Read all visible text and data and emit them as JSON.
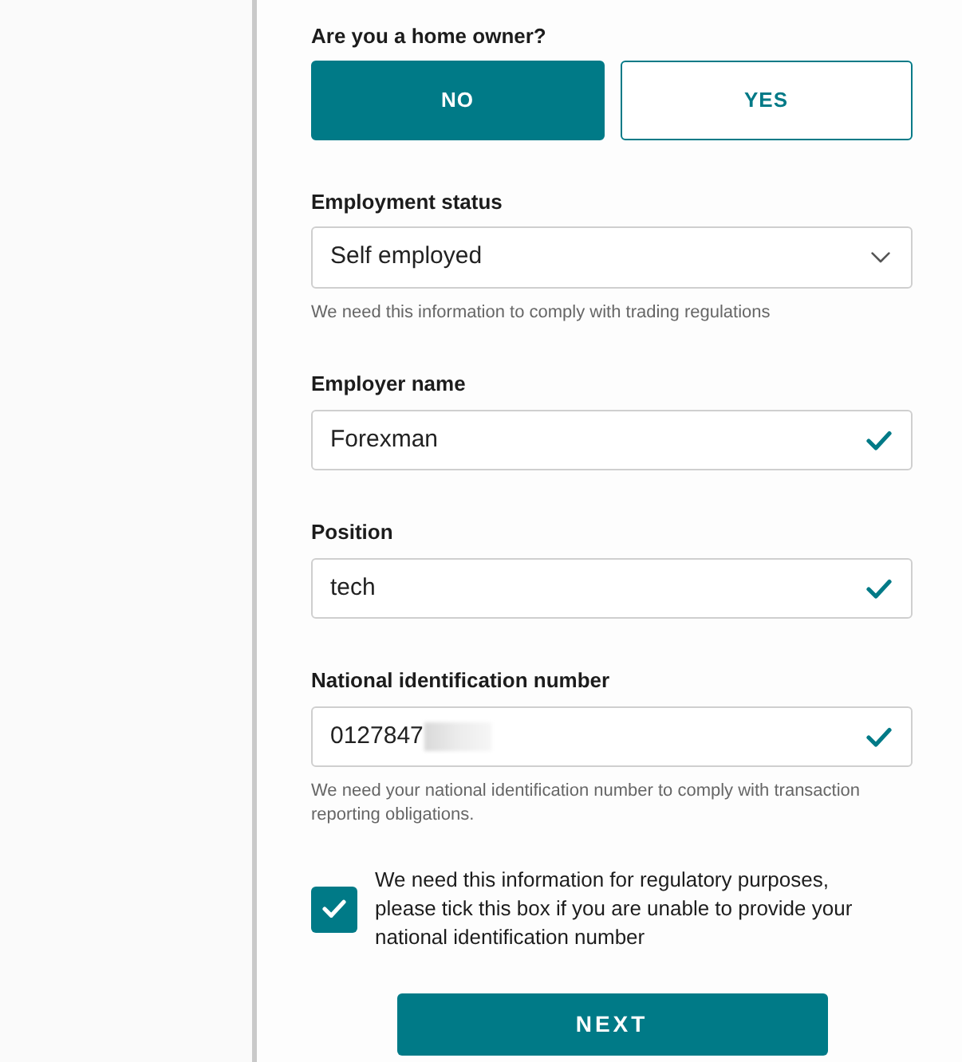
{
  "home_owner": {
    "label": "Are you a home owner?",
    "options": [
      {
        "label": "NO",
        "selected": true
      },
      {
        "label": "YES",
        "selected": false
      }
    ]
  },
  "fields": [
    {
      "kind": "select",
      "label": "Employment status",
      "value": "Self employed",
      "helper": "We need this information to comply with trading regulations"
    },
    {
      "kind": "input",
      "label": "Employer name",
      "value": "Forexman",
      "valid": true
    },
    {
      "kind": "input",
      "label": "Position",
      "value": "tech",
      "valid": true
    },
    {
      "kind": "input",
      "label": "National identification number",
      "value": "0127847",
      "redacted": true,
      "valid": true,
      "helper": "We need your national identification number to comply with transaction reporting obligations."
    }
  ],
  "consent": {
    "checked": true,
    "text": "We need this information for regulatory purposes, please tick this box if you are unable to provide your national identification number"
  },
  "next_button": {
    "label": "NEXT"
  }
}
